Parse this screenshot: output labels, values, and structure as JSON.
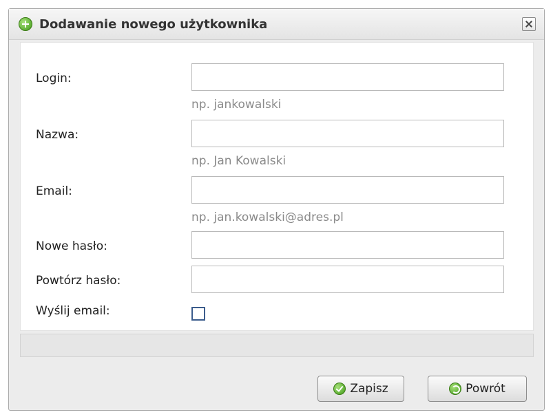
{
  "dialog": {
    "title": "Dodawanie nowego użytkownika",
    "title_icon": "add-icon",
    "close_icon": "close-icon"
  },
  "form": {
    "login": {
      "label": "Login:",
      "value": "",
      "hint": "np. jankowalski"
    },
    "nazwa": {
      "label": "Nazwa:",
      "value": "",
      "hint": "np. Jan Kowalski"
    },
    "email": {
      "label": "Email:",
      "value": "",
      "hint": "np. jan.kowalski@adres.pl"
    },
    "nowe_haslo": {
      "label": "Nowe hasło:",
      "value": ""
    },
    "powtorz_haslo": {
      "label": "Powtórz hasło:",
      "value": ""
    },
    "wyslij_email": {
      "label": "Wyślij email:",
      "checked": false
    }
  },
  "buttons": {
    "save_label": "Zapisz",
    "save_icon": "check-icon",
    "back_label": "Powrót",
    "back_icon": "refresh-back-icon"
  },
  "colors": {
    "icon_green": "#3f9a17",
    "checkbox_border": "#3b5c8c"
  }
}
